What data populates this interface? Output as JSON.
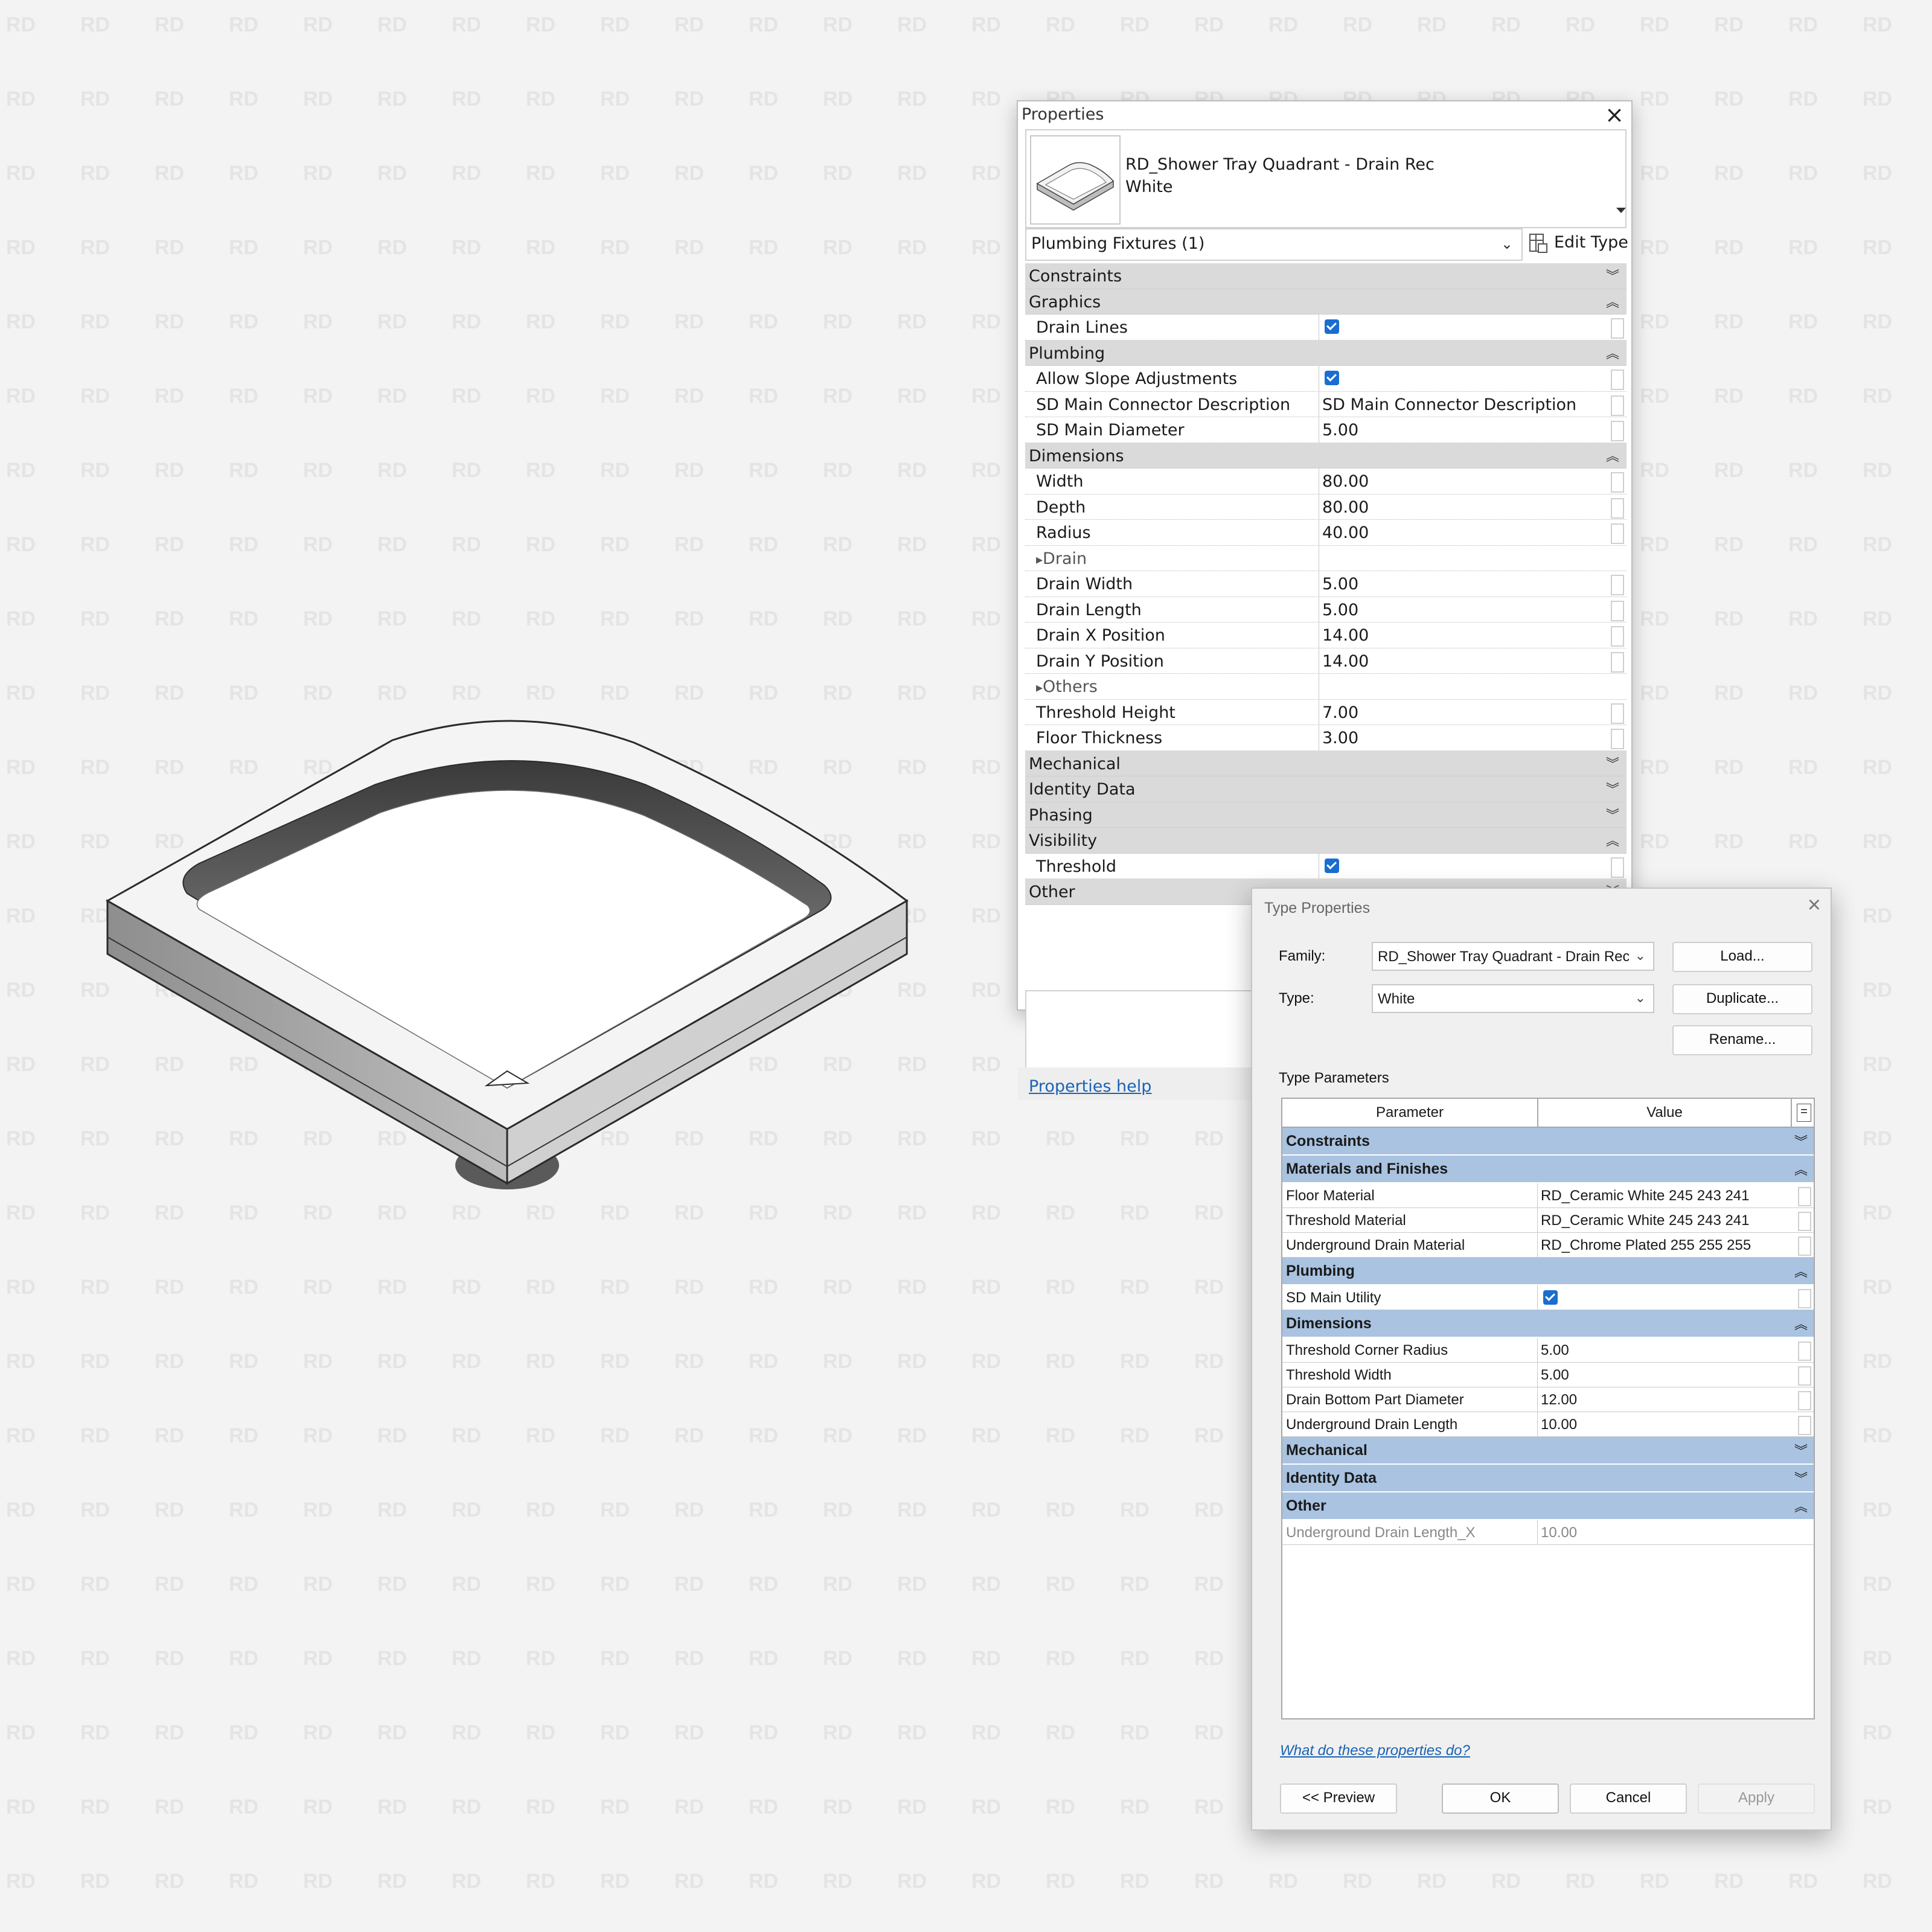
{
  "watermark": "RD",
  "properties": {
    "title": "Properties",
    "type_name_line1": "RD_Shower Tray Quadrant - Drain Rec",
    "type_name_line2": "White",
    "selector": "Plumbing Fixtures (1)",
    "edit_type": "Edit Type",
    "help": "Properties help",
    "rows": [
      {
        "kind": "group",
        "label": "Constraints",
        "state": "collapsed"
      },
      {
        "kind": "group",
        "label": "Graphics",
        "state": "expanded"
      },
      {
        "kind": "param",
        "label": "Drain Lines",
        "checked": true
      },
      {
        "kind": "group",
        "label": "Plumbing",
        "state": "expanded"
      },
      {
        "kind": "param",
        "label": "Allow Slope Adjustments",
        "checked": true
      },
      {
        "kind": "param",
        "label": "SD Main Connector Description",
        "value": "SD Main Connector Description"
      },
      {
        "kind": "param",
        "label": "SD Main Diameter",
        "value": "5.00"
      },
      {
        "kind": "group",
        "label": "Dimensions",
        "state": "expanded"
      },
      {
        "kind": "param",
        "label": "Width",
        "value": "80.00"
      },
      {
        "kind": "param",
        "label": "Depth",
        "value": "80.00"
      },
      {
        "kind": "param",
        "label": "Radius",
        "value": "40.00"
      },
      {
        "kind": "sub",
        "label": "Drain"
      },
      {
        "kind": "param",
        "label": "Drain Width",
        "value": "5.00"
      },
      {
        "kind": "param",
        "label": "Drain Length",
        "value": "5.00"
      },
      {
        "kind": "param",
        "label": "Drain X Position",
        "value": "14.00"
      },
      {
        "kind": "param",
        "label": "Drain Y Position",
        "value": "14.00"
      },
      {
        "kind": "sub",
        "label": "Others"
      },
      {
        "kind": "param",
        "label": "Threshold Height",
        "value": "7.00"
      },
      {
        "kind": "param",
        "label": "Floor Thickness",
        "value": "3.00"
      },
      {
        "kind": "group",
        "label": "Mechanical",
        "state": "collapsed"
      },
      {
        "kind": "group",
        "label": "Identity Data",
        "state": "collapsed"
      },
      {
        "kind": "group",
        "label": "Phasing",
        "state": "collapsed"
      },
      {
        "kind": "group",
        "label": "Visibility",
        "state": "expanded"
      },
      {
        "kind": "param",
        "label": "Threshold",
        "checked": true
      },
      {
        "kind": "group",
        "label": "Other",
        "state": "collapsed"
      }
    ]
  },
  "type_properties": {
    "title": "Type Properties",
    "family_label": "Family:",
    "family_value": "RD_Shower Tray Quadrant - Drain Rec",
    "type_label": "Type:",
    "type_value": "White",
    "load": "Load...",
    "duplicate": "Duplicate...",
    "rename": "Rename...",
    "section_label": "Type Parameters",
    "col_parameter": "Parameter",
    "col_value": "Value",
    "col_extra": "=",
    "rows": [
      {
        "kind": "group",
        "label": "Constraints",
        "state": "collapsed"
      },
      {
        "kind": "group",
        "label": "Materials and Finishes",
        "state": "expanded"
      },
      {
        "kind": "param",
        "label": "Floor Material",
        "value": "RD_Ceramic White 245 243 241"
      },
      {
        "kind": "param",
        "label": "Threshold Material",
        "value": "RD_Ceramic White 245 243 241"
      },
      {
        "kind": "param",
        "label": "Underground Drain Material",
        "value": "RD_Chrome Plated 255 255 255"
      },
      {
        "kind": "group",
        "label": "Plumbing",
        "state": "expanded"
      },
      {
        "kind": "param",
        "label": "SD Main Utility",
        "checked": true
      },
      {
        "kind": "group",
        "label": "Dimensions",
        "state": "expanded"
      },
      {
        "kind": "param",
        "label": "Threshold Corner Radius",
        "value": "5.00"
      },
      {
        "kind": "param",
        "label": "Threshold Width",
        "value": "5.00"
      },
      {
        "kind": "param",
        "label": "Drain Bottom Part Diameter",
        "value": "12.00"
      },
      {
        "kind": "param",
        "label": "Underground Drain Length",
        "value": "10.00"
      },
      {
        "kind": "group",
        "label": "Mechanical",
        "state": "collapsed"
      },
      {
        "kind": "group",
        "label": "Identity Data",
        "state": "collapsed"
      },
      {
        "kind": "group",
        "label": "Other",
        "state": "expanded"
      },
      {
        "kind": "param",
        "label": "Underground Drain Length_X",
        "value": "10.00",
        "readonly": true
      }
    ],
    "help": "What do these properties do?",
    "preview": "<< Preview",
    "ok": "OK",
    "cancel": "Cancel",
    "apply": "Apply"
  },
  "colors": {
    "group_band_palette": "#dadada",
    "group_band_dialog": "#a9c3e1",
    "checkbox": "#1a6dd1",
    "link": "#1a63b5"
  }
}
